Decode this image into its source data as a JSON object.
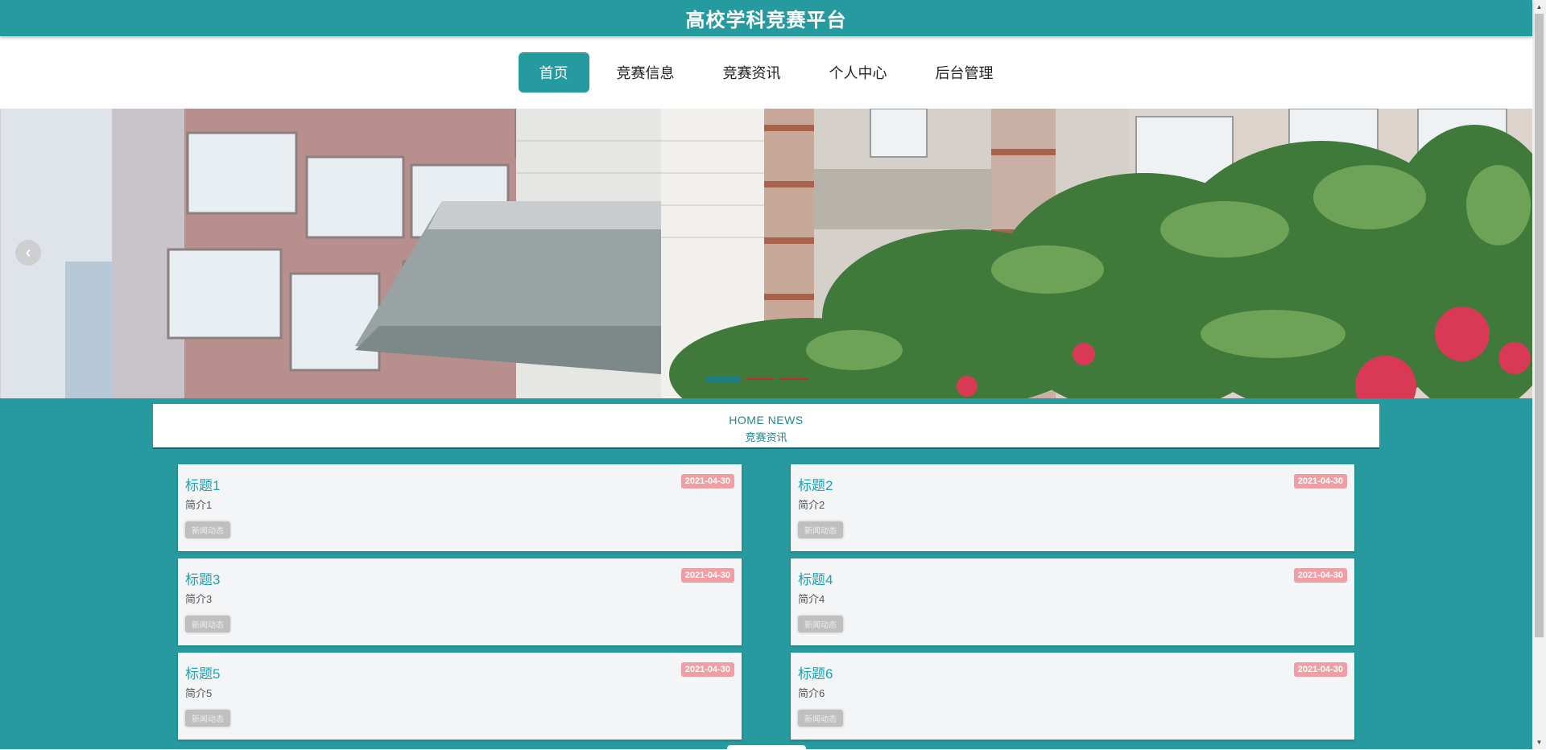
{
  "site": {
    "title": "高校学科竞赛平台"
  },
  "nav": {
    "items": [
      {
        "label": "首页",
        "active": true
      },
      {
        "label": "竞赛信息",
        "active": false
      },
      {
        "label": "竞赛资讯",
        "active": false
      },
      {
        "label": "个人中心",
        "active": false
      },
      {
        "label": "后台管理",
        "active": false
      }
    ]
  },
  "carousel": {
    "prev_icon": "chevron-left-icon",
    "prev_glyph": "‹",
    "slide_count": 3,
    "active_slide": 1
  },
  "news": {
    "heading_en": "HOME NEWS",
    "heading_cn": "竞赛资讯",
    "cards": [
      {
        "title": "标题1",
        "date": "2021-04-30",
        "intro": "简介1",
        "tag": "新闻动态"
      },
      {
        "title": "标题2",
        "date": "2021-04-30",
        "intro": "简介2",
        "tag": "新闻动态"
      },
      {
        "title": "标题3",
        "date": "2021-04-30",
        "intro": "简介3",
        "tag": "新闻动态"
      },
      {
        "title": "标题4",
        "date": "2021-04-30",
        "intro": "简介4",
        "tag": "新闻动态"
      },
      {
        "title": "标题5",
        "date": "2021-04-30",
        "intro": "简介5",
        "tag": "新闻动态"
      },
      {
        "title": "标题6",
        "date": "2021-04-30",
        "intro": "简介6",
        "tag": "新闻动态"
      }
    ]
  },
  "colors": {
    "brand": "#259a9f",
    "title_link": "#21a0b0",
    "date_badge": "#ef9fa3"
  }
}
